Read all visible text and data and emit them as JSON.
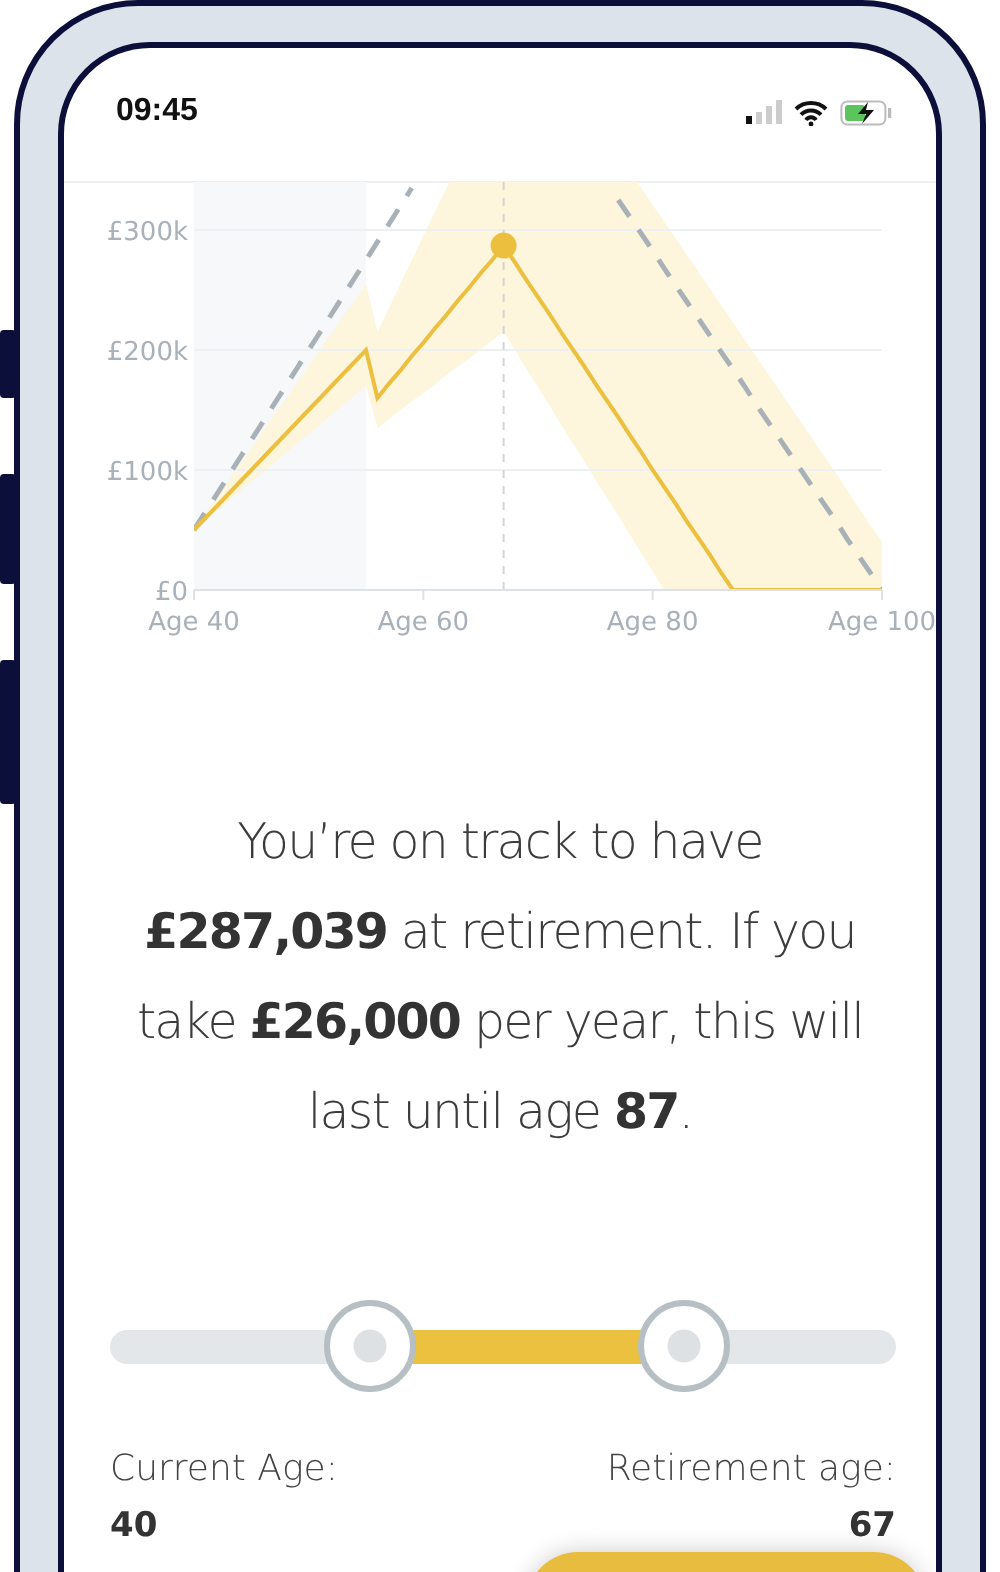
{
  "status_bar": {
    "time": "09:45"
  },
  "chart": {
    "chart_data": {
      "type": "line",
      "ylim": [
        0,
        340
      ],
      "categories": [
        "Age 40",
        null,
        null,
        null,
        null,
        null,
        null,
        null,
        null,
        null,
        null,
        null,
        null,
        null,
        null,
        null,
        null,
        null,
        null,
        null,
        "Age 60",
        null,
        null,
        null,
        null,
        null,
        null,
        null,
        null,
        null,
        null,
        null,
        null,
        null,
        null,
        null,
        null,
        null,
        null,
        null,
        "Age 80",
        null,
        null,
        null,
        null,
        null,
        null,
        null,
        null,
        null,
        null,
        null,
        null,
        null,
        null,
        null,
        null,
        null,
        null,
        null,
        "Age 100"
      ],
      "yticks": [
        {
          "value": 0,
          "label": "£0"
        },
        {
          "value": 100,
          "label": "£100k"
        },
        {
          "value": 200,
          "label": "£200k"
        },
        {
          "value": 300,
          "label": "£300k"
        }
      ],
      "series": [
        {
          "type": "area",
          "color": "#ffffff",
          "values": [
            50,
            58,
            66,
            74,
            82,
            90,
            98,
            106,
            114,
            122,
            130,
            138,
            146,
            154,
            162,
            170,
            135,
            142,
            150,
            157,
            164,
            171,
            179,
            186,
            193,
            200,
            208,
            215,
            200,
            184,
            169,
            154,
            138,
            123,
            108,
            92,
            77,
            62,
            46,
            31,
            15,
            0,
            0,
            0,
            0,
            0,
            0,
            0,
            0,
            0,
            0,
            0,
            0,
            0,
            0,
            0,
            0,
            0,
            0,
            0,
            0
          ]
        },
        {
          "type": "area",
          "color": "#fdf5dc",
          "values": [
            50,
            64,
            77,
            91,
            105,
            118,
            132,
            146,
            159,
            173,
            187,
            200,
            214,
            228,
            241,
            255,
            215,
            235,
            255,
            275,
            295,
            315,
            335,
            null,
            null,
            null,
            null,
            null,
            null,
            null,
            null,
            null,
            null,
            null,
            null,
            null,
            null,
            null,
            null,
            335,
            321,
            307,
            293,
            279,
            265,
            251,
            237,
            223,
            209,
            195,
            181,
            167,
            153,
            139,
            125,
            111,
            97,
            83,
            68,
            54,
            40
          ]
        },
        {
          "type": "line",
          "line_style": "dashed",
          "color": "#a9b1b8",
          "values": [
            50,
            65,
            80,
            95,
            110,
            125,
            140,
            155,
            170,
            185,
            200,
            215,
            230,
            245,
            260,
            275,
            290,
            305,
            320,
            335,
            null,
            null,
            null,
            null,
            null,
            null,
            null,
            null,
            null,
            null,
            null,
            null,
            null,
            null,
            null,
            null,
            null,
            325,
            311,
            297,
            283,
            268,
            254,
            240,
            226,
            212,
            198,
            184,
            170,
            155,
            141,
            127,
            113,
            99,
            85,
            71,
            57,
            42,
            28,
            14,
            0
          ]
        },
        {
          "type": "line",
          "color": "#ecc03e",
          "values": [
            50,
            60,
            70,
            80,
            90,
            100,
            110,
            120,
            130,
            140,
            150,
            160,
            170,
            180,
            190,
            200,
            160,
            172,
            183,
            195,
            206,
            218,
            229,
            241,
            252,
            264,
            275,
            287,
            273,
            258,
            244,
            230,
            215,
            201,
            187,
            172,
            158,
            144,
            129,
            115,
            100,
            86,
            72,
            57,
            43,
            29,
            14,
            0,
            0,
            0,
            0,
            0,
            0,
            0,
            0,
            0,
            0,
            0,
            0,
            0,
            0
          ]
        }
      ],
      "grid": true
    }
  },
  "summary": "You’re on track to have **£287,039** at retirement. If you take **£26,000** per year, this will last until age **87**.",
  "slider": {
    "thumbs": [
      {
        "level": 0.33
      },
      {
        "level": 0.73
      }
    ]
  },
  "ages": [
    {
      "label": "Current Age:",
      "value": "40"
    },
    {
      "label": "Retirement age:",
      "value": "67"
    }
  ]
}
